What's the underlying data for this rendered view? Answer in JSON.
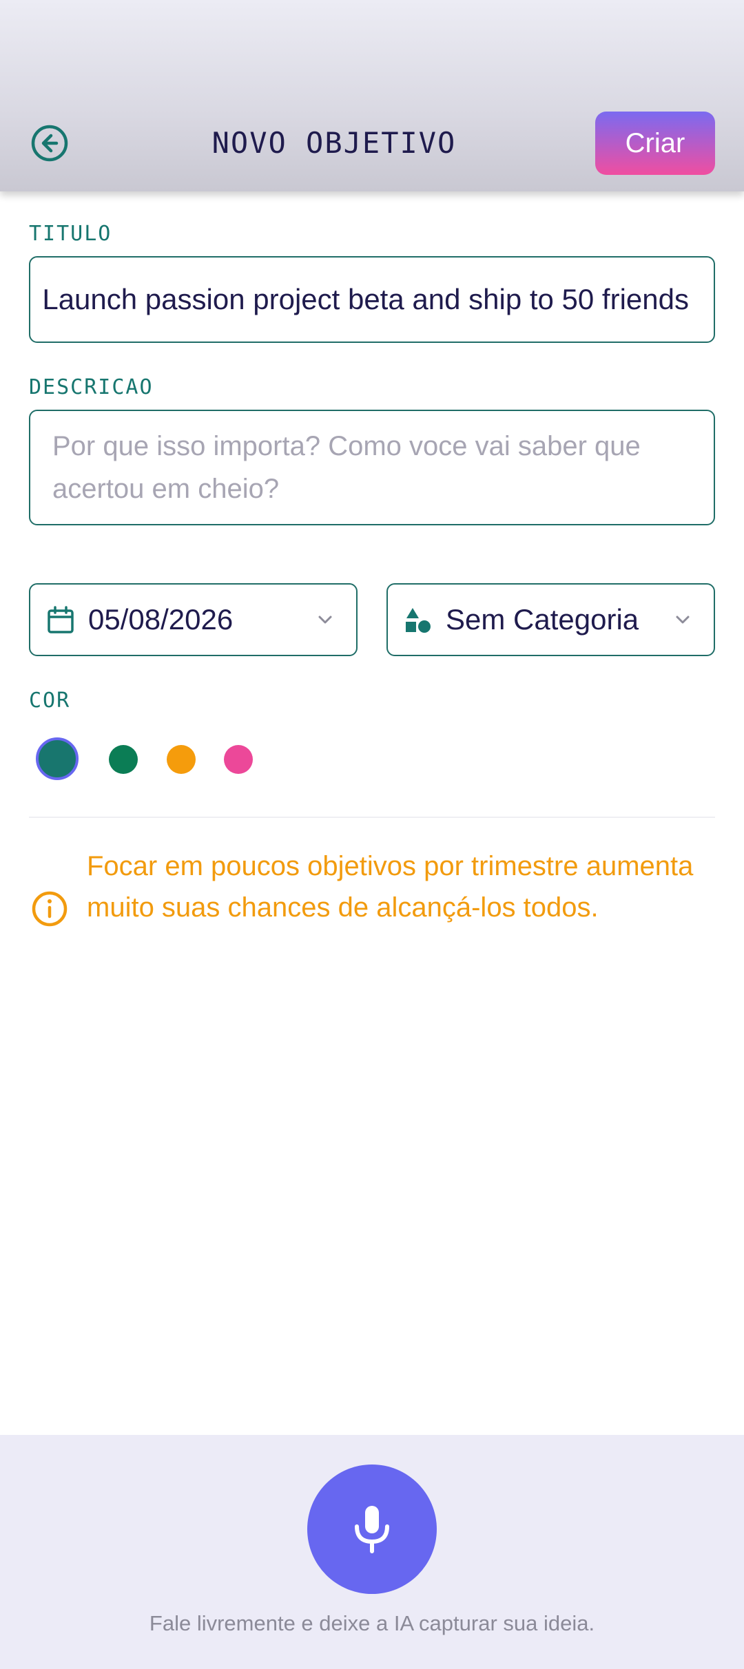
{
  "header": {
    "title": "NOVO OBJETIVO",
    "create_label": "Criar",
    "back_icon": "arrow-left-circle-icon"
  },
  "form": {
    "title_label": "TITULO",
    "title_value": "Launch passion project beta and ship to 50 friends",
    "description_label": "DESCRICAO",
    "description_placeholder": "Por que isso importa? Como voce vai saber que acertou em cheio?",
    "date_value": "05/08/2026",
    "category_value": "Sem Categoria",
    "color_label": "COR",
    "colors": [
      {
        "name": "teal",
        "hex": "#18766e",
        "selected": true
      },
      {
        "name": "green",
        "hex": "#0b7d55",
        "selected": false
      },
      {
        "name": "orange",
        "hex": "#f59c0c",
        "selected": false
      },
      {
        "name": "pink",
        "hex": "#ec4899",
        "selected": false
      }
    ]
  },
  "info": {
    "icon": "info-circle-icon",
    "text": "Focar em poucos objetivos por trimestre aumenta muito suas chances de alcançá-los todos."
  },
  "voice": {
    "icon": "microphone-icon",
    "hint": "Fale livremente e deixe a IA capturar sua ideia."
  },
  "theme": {
    "accent": "#1f6d67",
    "primary_text": "#1f1b4d",
    "warning": "#f29b0e",
    "mic": "#6767f0"
  }
}
